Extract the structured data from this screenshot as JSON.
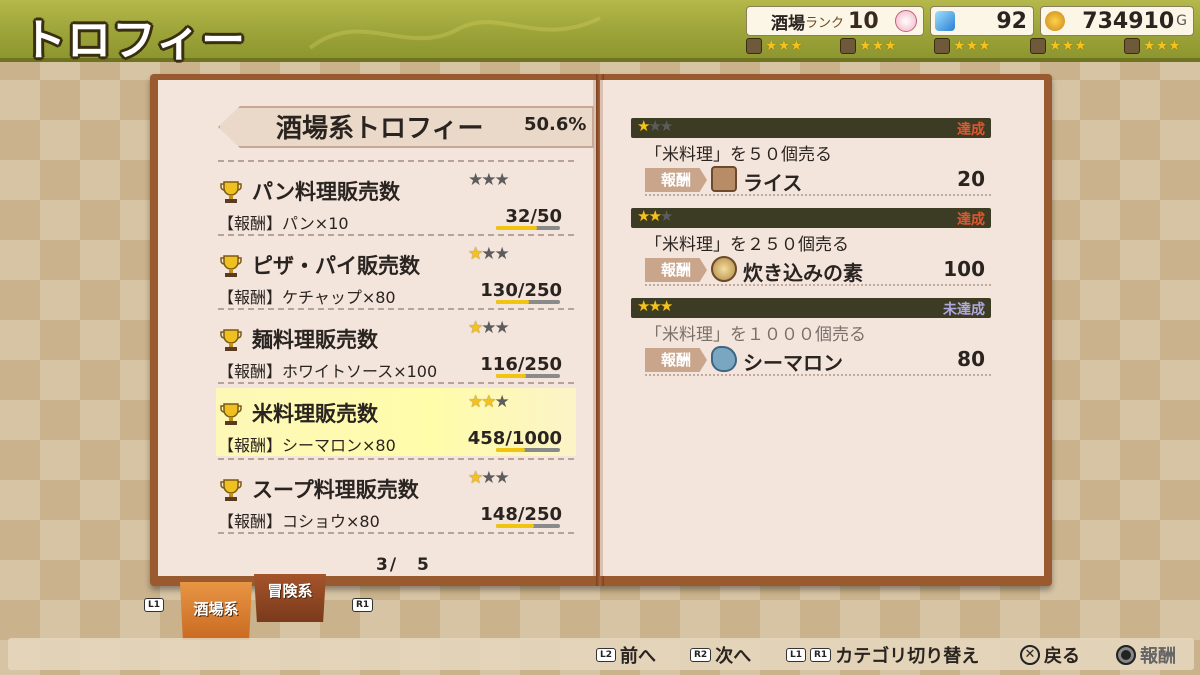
{
  "header": {
    "title": "トロフィー",
    "rank_label": "酒場",
    "rank_sub": "ランク",
    "rank_value": "10",
    "gems": "92",
    "gold": "734910",
    "gold_suffix": "G",
    "ratings": [
      {
        "icon": "tavern-sign-icon",
        "stars": 3
      },
      {
        "icon": "book-icon",
        "stars": 3
      },
      {
        "icon": "chest-icon",
        "stars": 3
      },
      {
        "icon": "pot-icon",
        "stars": 3
      },
      {
        "icon": "bag-icon",
        "stars": 3
      }
    ]
  },
  "left_page": {
    "category_title": "酒場系トロフィー",
    "category_percent": "50.6%",
    "page_indicator": "3/　5",
    "trophies": [
      {
        "name": "パン料理販売数",
        "reward": "【報酬】パン×10",
        "progress": "32/50",
        "filled_stars": 0,
        "fraction": 0.64
      },
      {
        "name": "ピザ・パイ販売数",
        "reward": "【報酬】ケチャップ×80",
        "progress": "130/250",
        "filled_stars": 1,
        "fraction": 0.52
      },
      {
        "name": "麺料理販売数",
        "reward": "【報酬】ホワイトソース×100",
        "progress": "116/250",
        "filled_stars": 1,
        "fraction": 0.464
      },
      {
        "name": "米料理販売数",
        "reward": "【報酬】シーマロン×80",
        "progress": "458/1000",
        "filled_stars": 2,
        "fraction": 0.458
      },
      {
        "name": "スープ料理販売数",
        "reward": "【報酬】コショウ×80",
        "progress": "148/250",
        "filled_stars": 1,
        "fraction": 0.592
      }
    ]
  },
  "right_page": {
    "goals": [
      {
        "filled_stars": 1,
        "status": "達成",
        "done": true,
        "text": "「米料理」を５０個売る",
        "reward_tag": "報酬",
        "reward_name": "ライス",
        "reward_qty": "20",
        "reward_icon": "rice-bag-icon"
      },
      {
        "filled_stars": 2,
        "status": "達成",
        "done": true,
        "text": "「米料理」を２５０個売る",
        "reward_tag": "報酬",
        "reward_name": "炊き込みの素",
        "reward_qty": "100",
        "reward_icon": "seasoning-bowl-icon"
      },
      {
        "filled_stars": 3,
        "status": "未達成",
        "done": false,
        "text": "「米料理」を１０００個売る",
        "reward_tag": "報酬",
        "reward_name": "シーマロン",
        "reward_qty": "80",
        "reward_icon": "fish-icon"
      }
    ]
  },
  "tabs": {
    "left_key": "L1",
    "right_key": "R1",
    "tavern": "酒場系",
    "adventure": "冒険系"
  },
  "controls": {
    "prev_key": "L2",
    "prev_label": "前へ",
    "next_key": "R2",
    "next_label": "次へ",
    "cat_key1": "L1",
    "cat_key2": "R1",
    "cat_label": "カテゴリ切り替え",
    "back_label": "戻る",
    "reward_label": "報酬"
  },
  "colors": {
    "header_green": "#9aa238",
    "book_cover": "#9a5a30",
    "page": "#f3e4dc",
    "star_gold": "#f3c21c",
    "status_done": "#e4572e",
    "status_not_done": "#b0a8e0"
  }
}
